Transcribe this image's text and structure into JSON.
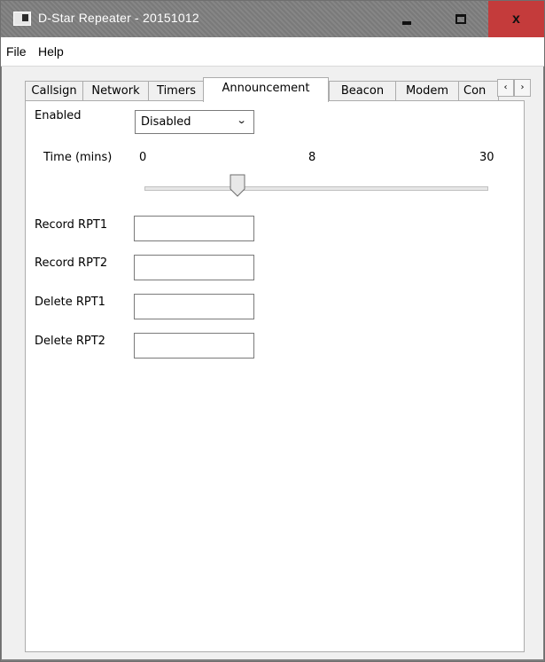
{
  "window": {
    "title": "D-Star Repeater - 20151012",
    "close_glyph": "x",
    "icons": {
      "minimize": "minimize-icon",
      "maximize": "maximize-icon",
      "close": "close-icon"
    }
  },
  "menu": {
    "file": "File",
    "help": "Help"
  },
  "tabs": [
    {
      "label": "Callsign"
    },
    {
      "label": "Network"
    },
    {
      "label": "Timers"
    },
    {
      "label": "Announcement",
      "active": true
    },
    {
      "label": "Beacon"
    },
    {
      "label": "Modem"
    },
    {
      "label": "Con"
    }
  ],
  "tab_scroll": {
    "left": "‹",
    "right": "›"
  },
  "announcement": {
    "enabled_label": "Enabled",
    "enabled_value": "Disabled",
    "time_label": "Time (mins)",
    "slider": {
      "min": "0",
      "value": "8",
      "max": "30",
      "position": 8
    },
    "fields": [
      {
        "label": "Record RPT1",
        "value": ""
      },
      {
        "label": "Record RPT2",
        "value": ""
      },
      {
        "label": "Delete RPT1",
        "value": ""
      },
      {
        "label": "Delete RPT2",
        "value": ""
      }
    ]
  },
  "colors": {
    "titlebar": "#808080",
    "close_button": "#c43b3b",
    "client_bg": "#f0f0f0",
    "panel_bg": "#ffffff"
  }
}
